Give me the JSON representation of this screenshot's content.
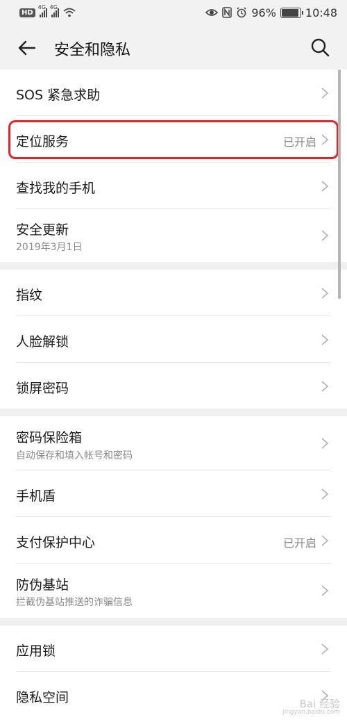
{
  "status_bar": {
    "network_badge": "HD",
    "sim1_label": "4G",
    "sim2_label": "4G",
    "battery_percent": "96%",
    "battery_level": 0.96,
    "time": "10:48"
  },
  "header": {
    "title": "安全和隐私"
  },
  "rows": [
    {
      "label": "SOS 紧急求助"
    },
    {
      "label": "定位服务",
      "value": "已开启"
    },
    {
      "label": "查找我的手机"
    },
    {
      "label": "安全更新",
      "sub": "2019年3月1日"
    },
    {
      "label": "指纹"
    },
    {
      "label": "人脸解锁"
    },
    {
      "label": "锁屏密码"
    },
    {
      "label": "密码保险箱",
      "sub": "自动保存和填入帐号和密码"
    },
    {
      "label": "手机盾"
    },
    {
      "label": "支付保护中心",
      "value": "已开启"
    },
    {
      "label": "防伪基站",
      "sub": "拦截伪基站推送的诈骗信息"
    },
    {
      "label": "应用锁"
    },
    {
      "label": "隐私空间"
    }
  ],
  "watermark": {
    "text": "Bai 经验",
    "url": "jingyan.baidu.com"
  },
  "colors": {
    "highlight": "#e0242a",
    "background": "#f0f0f0",
    "card": "#ffffff"
  }
}
